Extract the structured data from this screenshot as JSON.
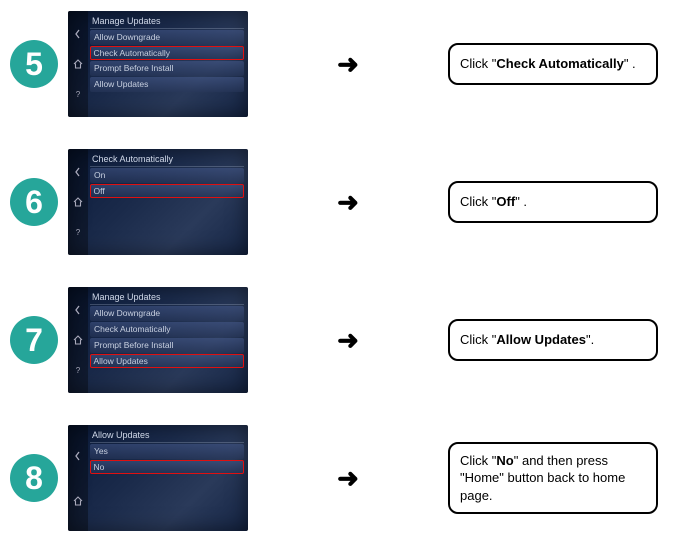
{
  "steps": {
    "s5": {
      "badge": "5",
      "title": "Manage Updates",
      "items": [
        "Allow Downgrade",
        "Check Automatically",
        "Prompt Before Install",
        "Allow Updates"
      ],
      "highlight_index": 1,
      "arrow": "➜",
      "caption_pre": "Click  \"",
      "caption_bold": "Check Automatically",
      "caption_post": "\"  ."
    },
    "s6": {
      "badge": "6",
      "title": "Check Automatically",
      "items": [
        "On",
        "Off"
      ],
      "highlight_index": 1,
      "arrow": "➜",
      "caption_pre": "Click \"",
      "caption_bold": "Off",
      "caption_post": "\" ."
    },
    "s7": {
      "badge": "7",
      "title": "Manage Updates",
      "items": [
        "Allow Downgrade",
        "Check Automatically",
        "Prompt Before Install",
        "Allow Updates"
      ],
      "highlight_index": 3,
      "arrow": "➜",
      "caption_pre": "Click \"",
      "caption_bold": "Allow Updates",
      "caption_post": "\"."
    },
    "s8": {
      "badge": "8",
      "title": "Allow Updates",
      "items": [
        "Yes",
        "No"
      ],
      "highlight_index": 1,
      "arrow": "➜",
      "caption_pre": "Click \"",
      "caption_bold": "No",
      "caption_post": "\" and then press \"Home\" button back to home page."
    }
  }
}
